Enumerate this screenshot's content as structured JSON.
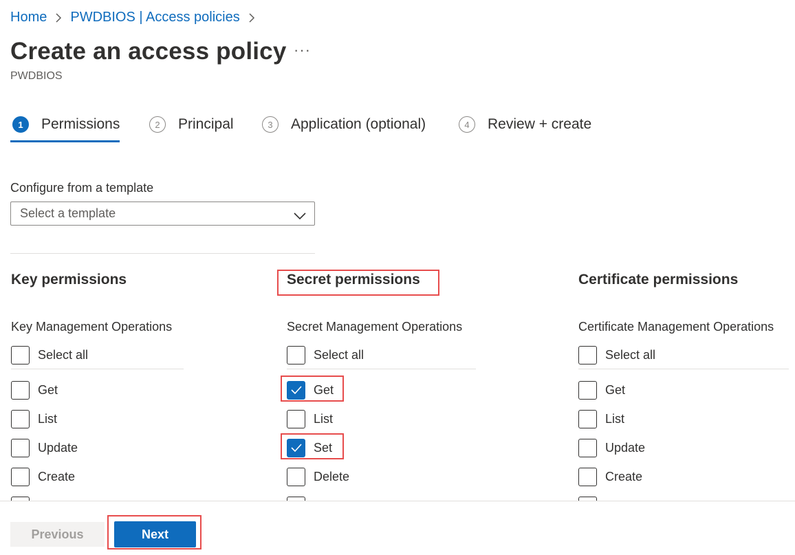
{
  "breadcrumb": {
    "items": [
      "Home",
      "PWDBIOS | Access policies"
    ]
  },
  "header": {
    "title": "Create an access policy",
    "more": "···",
    "subtitle": "PWDBIOS"
  },
  "steps": [
    {
      "num": "1",
      "label": "Permissions",
      "active": true
    },
    {
      "num": "2",
      "label": "Principal",
      "active": false
    },
    {
      "num": "3",
      "label": "Application (optional)",
      "active": false
    },
    {
      "num": "4",
      "label": "Review + create",
      "active": false
    }
  ],
  "template": {
    "label": "Configure from a template",
    "placeholder": "Select a template"
  },
  "columns": [
    {
      "title": "Key permissions",
      "ops_label": "Key Management Operations",
      "select_all": "Select all",
      "items": [
        {
          "label": "Get",
          "checked": false
        },
        {
          "label": "List",
          "checked": false
        },
        {
          "label": "Update",
          "checked": false
        },
        {
          "label": "Create",
          "checked": false
        }
      ]
    },
    {
      "title": "Secret permissions",
      "ops_label": "Secret Management Operations",
      "select_all": "Select all",
      "items": [
        {
          "label": "Get",
          "checked": true
        },
        {
          "label": "List",
          "checked": false
        },
        {
          "label": "Set",
          "checked": true
        },
        {
          "label": "Delete",
          "checked": false
        }
      ]
    },
    {
      "title": "Certificate permissions",
      "ops_label": "Certificate Management Operations",
      "select_all": "Select all",
      "items": [
        {
          "label": "Get",
          "checked": false
        },
        {
          "label": "List",
          "checked": false
        },
        {
          "label": "Update",
          "checked": false
        },
        {
          "label": "Create",
          "checked": false
        }
      ]
    }
  ],
  "footer": {
    "previous": "Previous",
    "next": "Next"
  },
  "colors": {
    "accent": "#0f6cbd",
    "highlight": "#e74c4c"
  }
}
